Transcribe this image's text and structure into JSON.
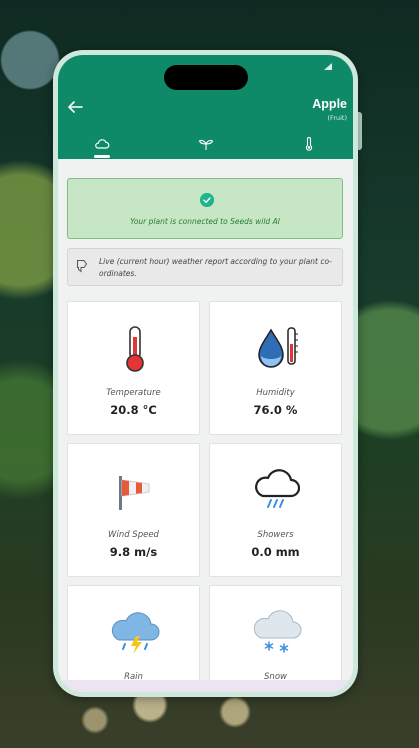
{
  "header": {
    "title": "Apple",
    "subtitle": "(Fruit)"
  },
  "tabs": [
    {
      "icon": "cloud-icon",
      "active": true
    },
    {
      "icon": "sprout-icon",
      "active": false
    },
    {
      "icon": "thermometer-icon",
      "active": false
    }
  ],
  "status": {
    "connected_message": "Your plant is connected to Seeds wild AI"
  },
  "info": {
    "text": "Live (current hour) weather report according to your plant co-ordinates."
  },
  "weather": [
    {
      "label": "Temperature",
      "value": "20.8 °C",
      "icon": "thermometer-icon"
    },
    {
      "label": "Humidity",
      "value": "76.0 %",
      "icon": "humidity-icon"
    },
    {
      "label": "Wind Speed",
      "value": "9.8 m/s",
      "icon": "windsock-icon"
    },
    {
      "label": "Showers",
      "value": "0.0 mm",
      "icon": "showers-icon"
    },
    {
      "label": "Rain",
      "value": "",
      "icon": "rain-storm-icon"
    },
    {
      "label": "Snow",
      "value": "",
      "icon": "snow-icon"
    }
  ],
  "colors": {
    "header": "#0f8a68",
    "success_bg": "#c7e6c6",
    "success_text": "#2d7d33",
    "check": "#1eb58b"
  }
}
